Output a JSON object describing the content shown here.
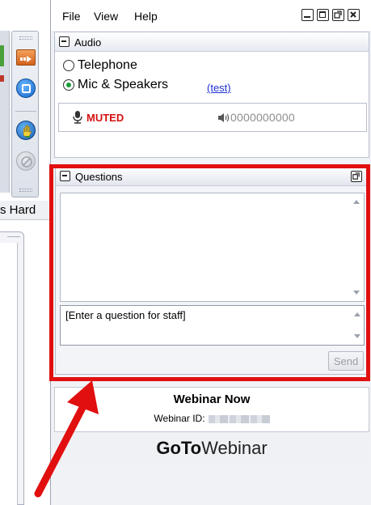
{
  "background_app": {
    "partial_text": "s Hard"
  },
  "menu": {
    "items": [
      "File",
      "View",
      "Help"
    ]
  },
  "audio": {
    "title": "Audio",
    "options": [
      "Telephone",
      "Mic & Speakers"
    ],
    "selected": "Mic & Speakers",
    "test_link": "(test)",
    "status": "MUTED",
    "level_display": "0000000000"
  },
  "questions": {
    "title": "Questions",
    "input_placeholder": "[Enter a question for staff]",
    "send_label": "Send"
  },
  "webinar": {
    "name": "Webinar Now",
    "id_label": "Webinar ID:"
  },
  "brand": {
    "goto": "GoTo",
    "webinar": "Webinar"
  },
  "colors": {
    "highlight": "#e10f0f",
    "muted": "#d51111",
    "link": "#1d2fd0",
    "radio_selected": "#1a9b3b"
  },
  "icons": [
    "dash-arrow-icon",
    "stop-square-icon",
    "raise-hand-icon",
    "disabled-icon",
    "microphone-icon",
    "speaker-icon",
    "minimize-icon",
    "maximize-icon",
    "popout-icon",
    "close-icon",
    "collapse-icon"
  ]
}
